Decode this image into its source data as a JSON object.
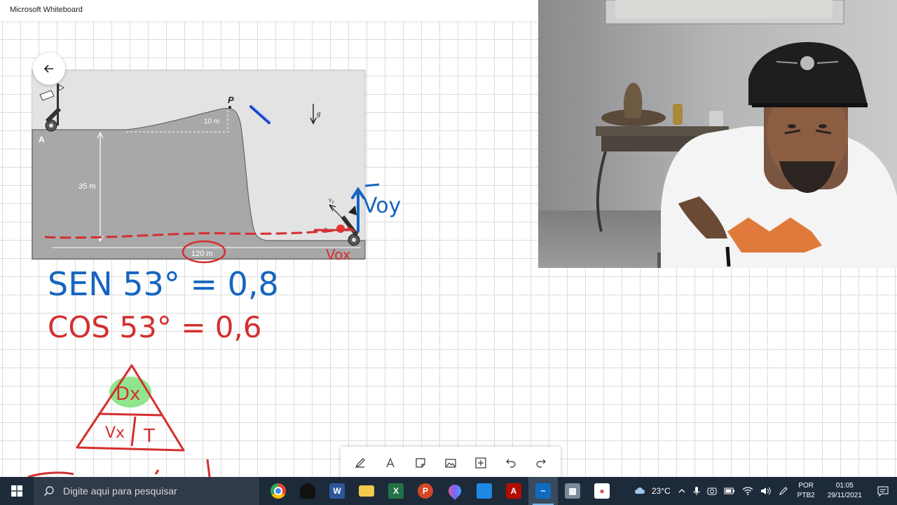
{
  "window": {
    "title": "Microsoft Whiteboard"
  },
  "figure": {
    "point_p": "P",
    "point_a": "A",
    "hill_height": "10 m",
    "cliff_height": "35 m",
    "distance": "120 m",
    "gravity": "g",
    "velocity": "v₀",
    "angle": "θ"
  },
  "ink": {
    "voy": "Voy",
    "vox": "Vox",
    "sin_line": "SEN 53° = 0,8",
    "cos_line": "COS 53° = 0,6",
    "triangle_top": "Dx",
    "triangle_left": "Vx",
    "triangle_right": "T",
    "colors": {
      "blue": "#1565c0",
      "red": "#d32f2f",
      "highlight": "#7ee07a"
    }
  },
  "toolbar": {
    "tools": [
      "pen-icon",
      "text-icon",
      "sticky-note-icon",
      "image-icon",
      "add-icon",
      "undo-icon",
      "redo-icon"
    ]
  },
  "taskbar": {
    "search_placeholder": "Digite aqui para pesquisar",
    "apps": [
      "chrome",
      "darth-vader-app",
      "word",
      "file-explorer",
      "excel",
      "powerpoint",
      "paint",
      "photos",
      "acrobat",
      "whiteboard",
      "calculator",
      "snip"
    ],
    "weather": "23°C",
    "lang_line1": "POR",
    "lang_line2": "PTB2",
    "time": "01:05",
    "date": "29/11/2021"
  }
}
